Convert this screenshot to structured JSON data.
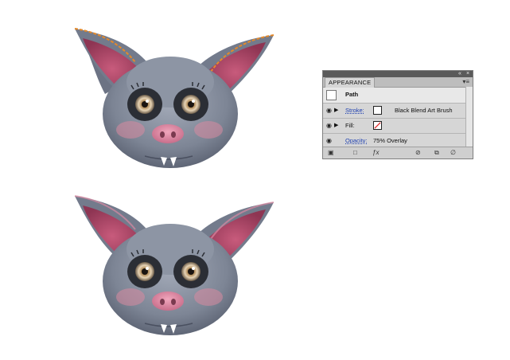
{
  "panel": {
    "tab_label": "APPEARANCE",
    "object_label": "Path",
    "stroke_label": "Stroke:",
    "stroke_value": "Black Blend Art Brush",
    "fill_label": "Fill:",
    "opacity_label": "Opacity:",
    "opacity_value": "75% Overlay",
    "topbar_left_control": "«",
    "topbar_close": "×",
    "menu_glyph": "▾≡"
  },
  "icons": {
    "visibility": "eye-icon",
    "disclosure": "triangle-right-icon",
    "new_stroke": "new-stroke-icon",
    "new_fill": "new-fill-icon",
    "fx": "fx-icon",
    "clear": "clear-appearance-icon",
    "duplicate": "duplicate-item-icon",
    "delete": "trash-icon"
  },
  "colors": {
    "bat_body": "#7f8797",
    "ear_inner": "#b44f6e",
    "nose": "#d98aa2",
    "accent_path": "#e3892b"
  }
}
